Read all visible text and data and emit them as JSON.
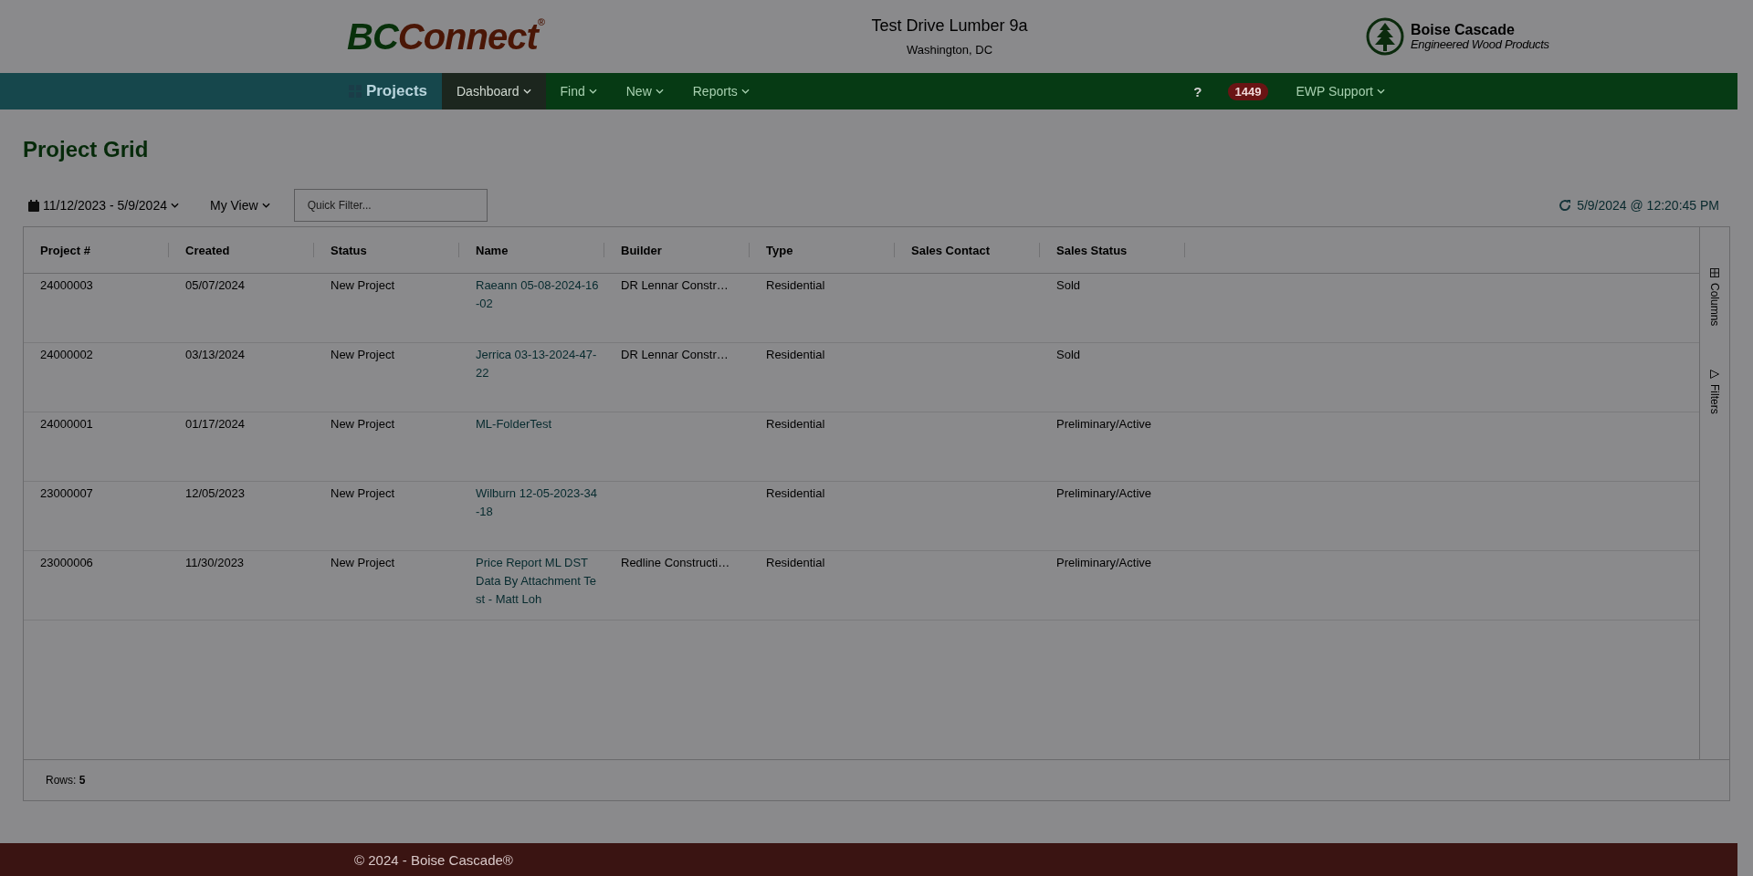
{
  "header": {
    "logo_left": "BC",
    "logo_right": "Connect",
    "logo_mark": "®",
    "company": "Test Drive Lumber 9a",
    "location": "Washington, DC",
    "brand_name": "Boise Cascade",
    "brand_tagline": "Engineered Wood Products"
  },
  "nav": {
    "home": "Projects",
    "items": [
      {
        "label": "Dashboard",
        "selected": true
      },
      {
        "label": "Find",
        "selected": false
      },
      {
        "label": "New",
        "selected": false
      },
      {
        "label": "Reports",
        "selected": false
      }
    ],
    "help": "?",
    "badge": "1449",
    "user": "EWP Support"
  },
  "page_title": "Project Grid",
  "toolbar": {
    "date_range": "11/12/2023 - 5/9/2024",
    "view": "My View",
    "filter_placeholder": "Quick Filter...",
    "refreshed": "5/9/2024 @ 12:20:45 PM"
  },
  "table": {
    "columns": [
      "Project #",
      "Created",
      "Status",
      "Name",
      "Builder",
      "Type",
      "Sales Contact",
      "Sales Status"
    ],
    "rows": [
      [
        "24000003",
        "05/07/2024",
        "New Project",
        "Raeann 05-08-2024-16-02",
        "DR Lennar Constr…",
        "Residential",
        "",
        "Sold"
      ],
      [
        "24000002",
        "03/13/2024",
        "New Project",
        "Jerrica 03-13-2024-47-22",
        "DR Lennar Constr…",
        "Residential",
        "",
        "Sold"
      ],
      [
        "24000001",
        "01/17/2024",
        "New Project",
        "ML-FolderTest",
        "",
        "Residential",
        "",
        "Preliminary/Active"
      ],
      [
        "23000007",
        "12/05/2023",
        "New Project",
        "Wilburn 12-05-2023-34-18",
        "",
        "Residential",
        "",
        "Preliminary/Active"
      ],
      [
        "23000006",
        "11/30/2023",
        "New Project",
        "Price Report ML DST Data By Attachment Test - Matt Loh",
        "Redline Constructi…",
        "Residential",
        "",
        "Preliminary/Active"
      ]
    ],
    "side_tabs": [
      "Columns",
      "Filters"
    ],
    "rows_label": "Rows:",
    "rows_count": "5"
  },
  "footer": "© 2024 - Boise Cascade®"
}
